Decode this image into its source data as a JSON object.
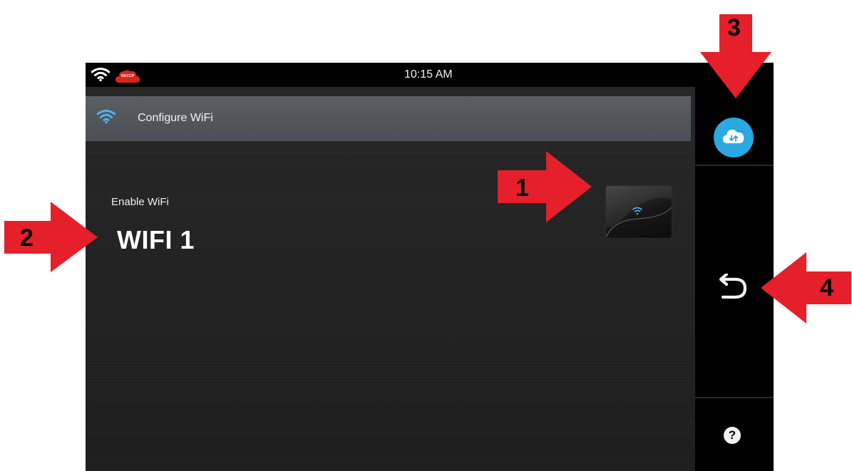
{
  "status_bar": {
    "time": "10:15 AM",
    "badge_text": "HACCP",
    "icons": [
      "wifi-icon",
      "haccp-cloud-icon"
    ]
  },
  "header": {
    "title": "Configure WiFi",
    "icon": "wifi-icon"
  },
  "settings": {
    "enable_label": "Enable WiFi",
    "toggle_icon": "wifi-icon"
  },
  "overlay_label": "WIFI 1",
  "sidebar": {
    "buttons": [
      {
        "icon": "cloud-sync-icon"
      },
      {
        "icon": "back-icon"
      },
      {
        "icon": "help-icon",
        "label": "?"
      }
    ]
  },
  "annotations": [
    {
      "number": "1",
      "direction": "right"
    },
    {
      "number": "2",
      "direction": "right"
    },
    {
      "number": "3",
      "direction": "down"
    },
    {
      "number": "4",
      "direction": "left"
    }
  ],
  "colors": {
    "accent_blue": "#2aa8e0",
    "wifi_blue": "#4fb3f0",
    "annotation_red": "#e5202a",
    "header_bar": "#53585d"
  }
}
